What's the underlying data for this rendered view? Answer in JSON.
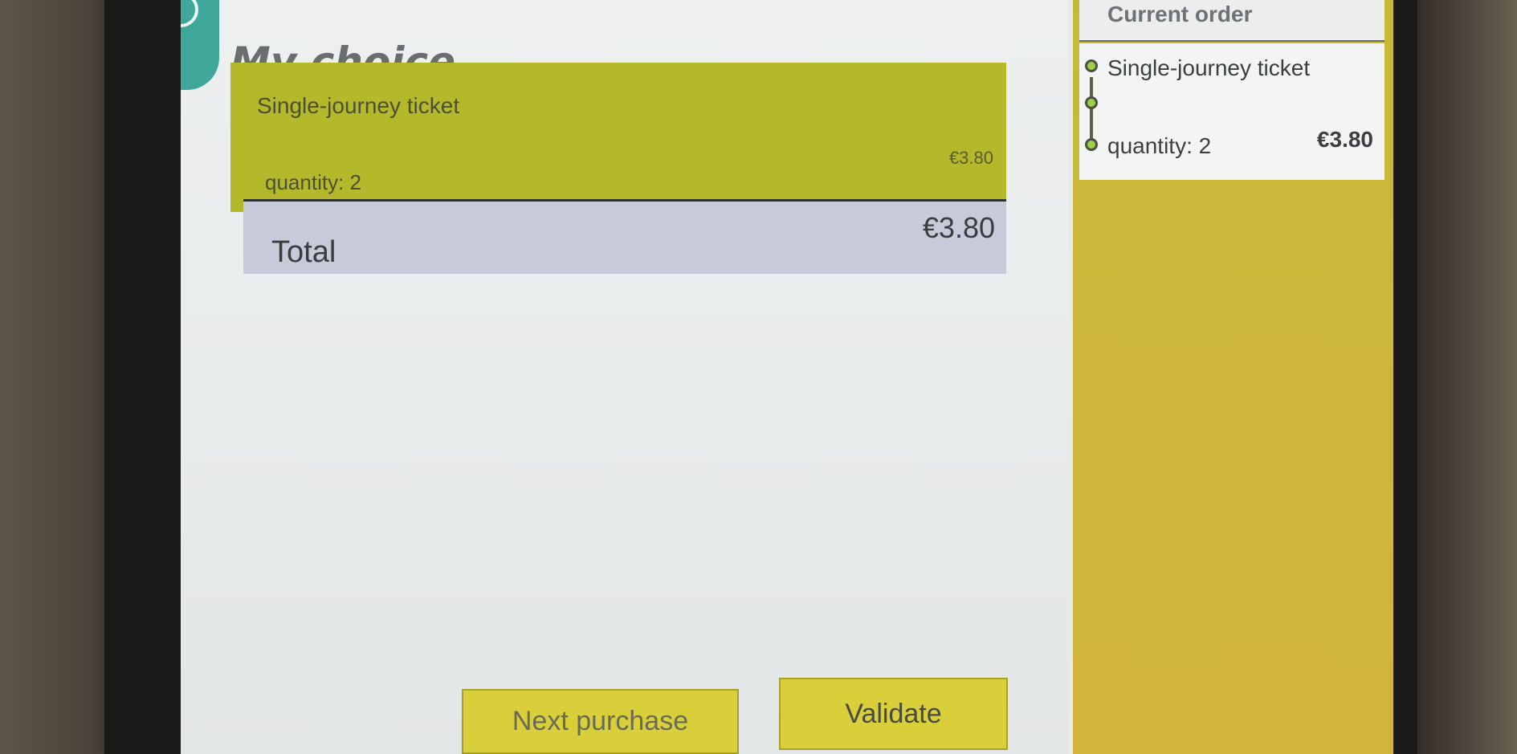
{
  "main": {
    "title": "My choice",
    "item": {
      "name": "Single-journey ticket",
      "quantity_text": "quantity: 2",
      "price": "€3.80"
    },
    "total": {
      "label": "Total",
      "value": "€3.80"
    }
  },
  "buttons": {
    "next_purchase": "Next purchase",
    "validate": "Validate"
  },
  "sidebar": {
    "header": "Current order",
    "item": {
      "name": "Single-journey ticket",
      "quantity_text": "quantity: 2",
      "price": "€3.80"
    }
  },
  "colors": {
    "accent_olive": "#b3b92a",
    "button_yellow": "#d8cf3a",
    "sidebar_yellow": "#cdb73c",
    "logo_teal": "#3fa79a",
    "total_bar": "#c7cad9"
  },
  "icons": {
    "logo": "transit-logo-icon",
    "timeline": "timeline-icon"
  }
}
